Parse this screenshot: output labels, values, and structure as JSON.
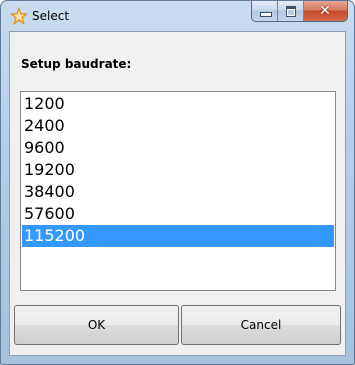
{
  "window": {
    "title": "Select",
    "icon": "star-icon",
    "controls": [
      "minimize-icon",
      "maximize-icon",
      "close-icon"
    ]
  },
  "dialog": {
    "prompt": "Setup baudrate:",
    "options": [
      "1200",
      "2400",
      "9600",
      "19200",
      "38400",
      "57600",
      "115200"
    ],
    "selected": "115200",
    "ok_label": "OK",
    "cancel_label": "Cancel",
    "close_glyph": "✕"
  },
  "colors": {
    "selection": "#3399ff",
    "icon_star": "#f0a020"
  }
}
